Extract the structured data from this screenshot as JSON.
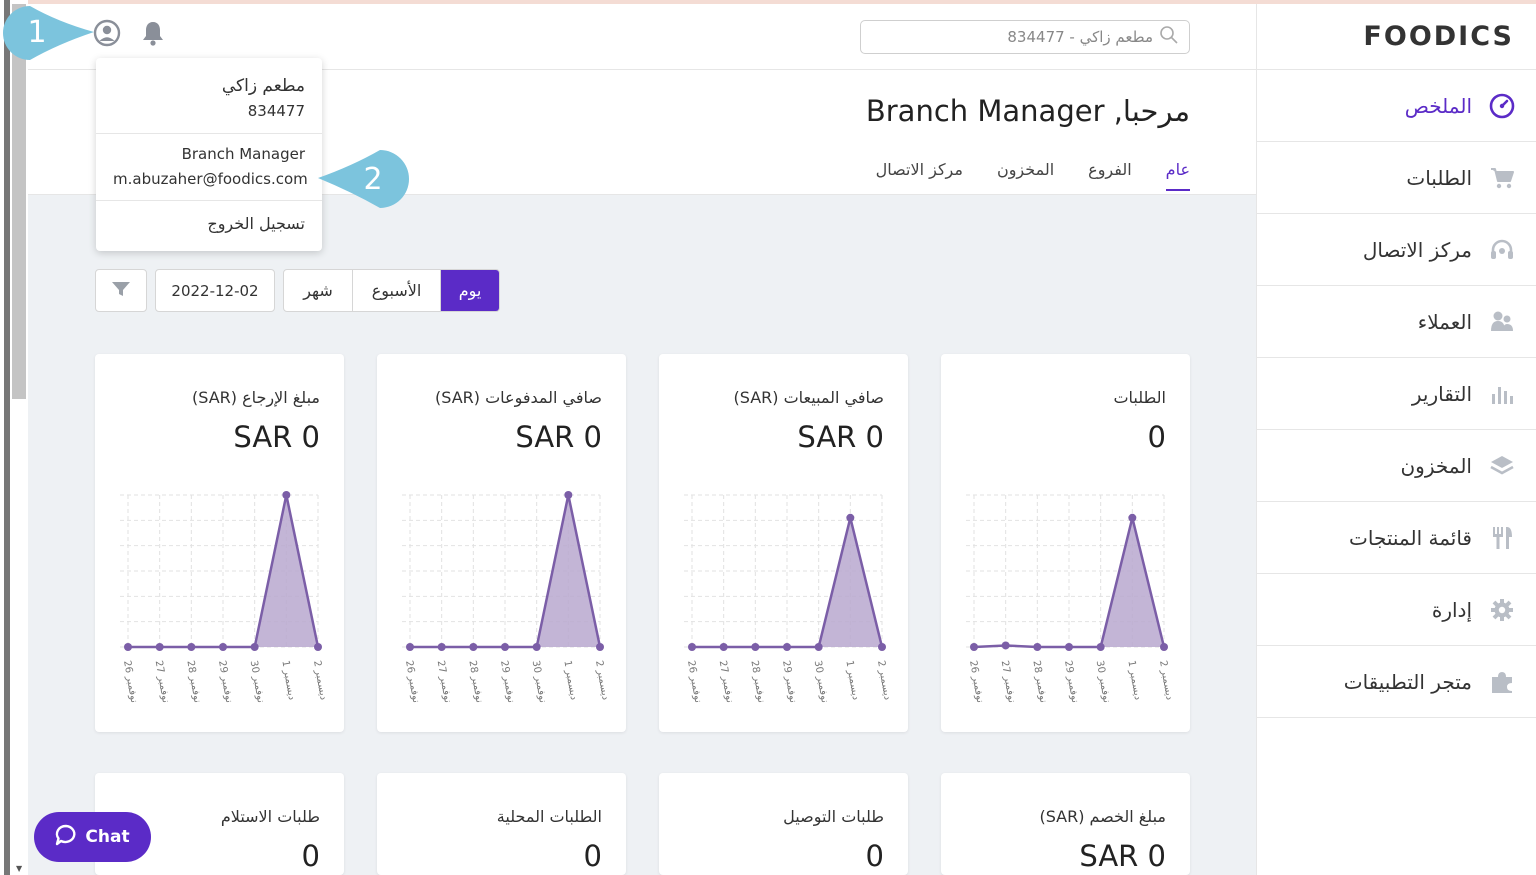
{
  "brand": {
    "logo_text": "FOODICS"
  },
  "search": {
    "value": "مطعم زاكي - 834477"
  },
  "sidebar": {
    "items": [
      {
        "label": "الملخص",
        "icon": "dashboard-gauge-icon",
        "active": true
      },
      {
        "label": "الطلبات",
        "icon": "cart-icon"
      },
      {
        "label": "مركز الاتصال",
        "icon": "headset-icon"
      },
      {
        "label": "العملاء",
        "icon": "users-icon"
      },
      {
        "label": "التقارير",
        "icon": "bar-chart-icon"
      },
      {
        "label": "المخزون",
        "icon": "layers-icon"
      },
      {
        "label": "قائمة المنتجات",
        "icon": "utensils-icon"
      },
      {
        "label": "إدارة",
        "icon": "gear-icon"
      },
      {
        "label": "متجر التطبيقات",
        "icon": "puzzle-icon"
      }
    ]
  },
  "welcome": {
    "title": "مرحبا, Branch Manager",
    "tabs": [
      "عام",
      "الفروع",
      "المخزون",
      "مركز الاتصال"
    ],
    "active_tab": "عام"
  },
  "filters": {
    "periods": [
      "يوم",
      "الأسبوع",
      "شهر"
    ],
    "active_period": "يوم",
    "date": "2022-12-02"
  },
  "user_menu": {
    "restaurant_name": "مطعم زاكي",
    "restaurant_id": "834477",
    "user_role": "Branch Manager",
    "user_email": "m.abuzaher@foodics.com",
    "logout_label": "تسجيل الخروج"
  },
  "callouts": {
    "one": "1",
    "two": "2"
  },
  "chat": {
    "label": "Chat"
  },
  "colors": {
    "accent": "#5b2bc7",
    "chart_line": "#7b5ea7",
    "chart_fill": "#b8a8cf"
  },
  "cards": [
    {
      "title": "الطلبات",
      "value": "0"
    },
    {
      "title": "صافي المبيعات (SAR)",
      "value": "SAR 0"
    },
    {
      "title": "صافي المدفوعات (SAR)",
      "value": "SAR 0"
    },
    {
      "title": "مبلغ الإرجاع (SAR)",
      "value": "SAR 0"
    },
    {
      "title": "مبلغ الخصم (SAR)",
      "value": "SAR 0"
    },
    {
      "title": "طلبات التوصيل",
      "value": "0"
    },
    {
      "title": "الطلبات المحلية",
      "value": "0"
    },
    {
      "title": "طلبات الاستلام",
      "value": "0"
    }
  ],
  "chart_data": [
    {
      "type": "area",
      "x": [
        "26 نوفمبر",
        "27 نوفمبر",
        "28 نوفمبر",
        "29 نوفمبر",
        "30 نوفمبر",
        "1 ديسمبر",
        "2 ديسمبر"
      ],
      "values": [
        0,
        0.01,
        0,
        0,
        0,
        0.85,
        0
      ],
      "ylim": [
        0,
        1
      ],
      "grid": true
    },
    {
      "type": "area",
      "x": [
        "26 نوفمبر",
        "27 نوفمبر",
        "28 نوفمبر",
        "29 نوفمبر",
        "30 نوفمبر",
        "1 ديسمبر",
        "2 ديسمبر"
      ],
      "values": [
        0,
        0,
        0,
        0,
        0,
        0.85,
        0
      ],
      "ylim": [
        0,
        1
      ],
      "grid": true
    },
    {
      "type": "area",
      "x": [
        "26 نوفمبر",
        "27 نوفمبر",
        "28 نوفمبر",
        "29 نوفمبر",
        "30 نوفمبر",
        "1 ديسمبر",
        "2 ديسمبر"
      ],
      "values": [
        0,
        0,
        0,
        0,
        0,
        1,
        0
      ],
      "ylim": [
        0,
        1
      ],
      "grid": true
    },
    {
      "type": "area",
      "x": [
        "26 نوفمبر",
        "27 نوفمبر",
        "28 نوفمبر",
        "29 نوفمبر",
        "30 نوفمبر",
        "1 ديسمبر",
        "2 ديسمبر"
      ],
      "values": [
        0,
        0,
        0,
        0,
        0,
        1,
        0
      ],
      "ylim": [
        0,
        1
      ],
      "grid": true
    }
  ]
}
